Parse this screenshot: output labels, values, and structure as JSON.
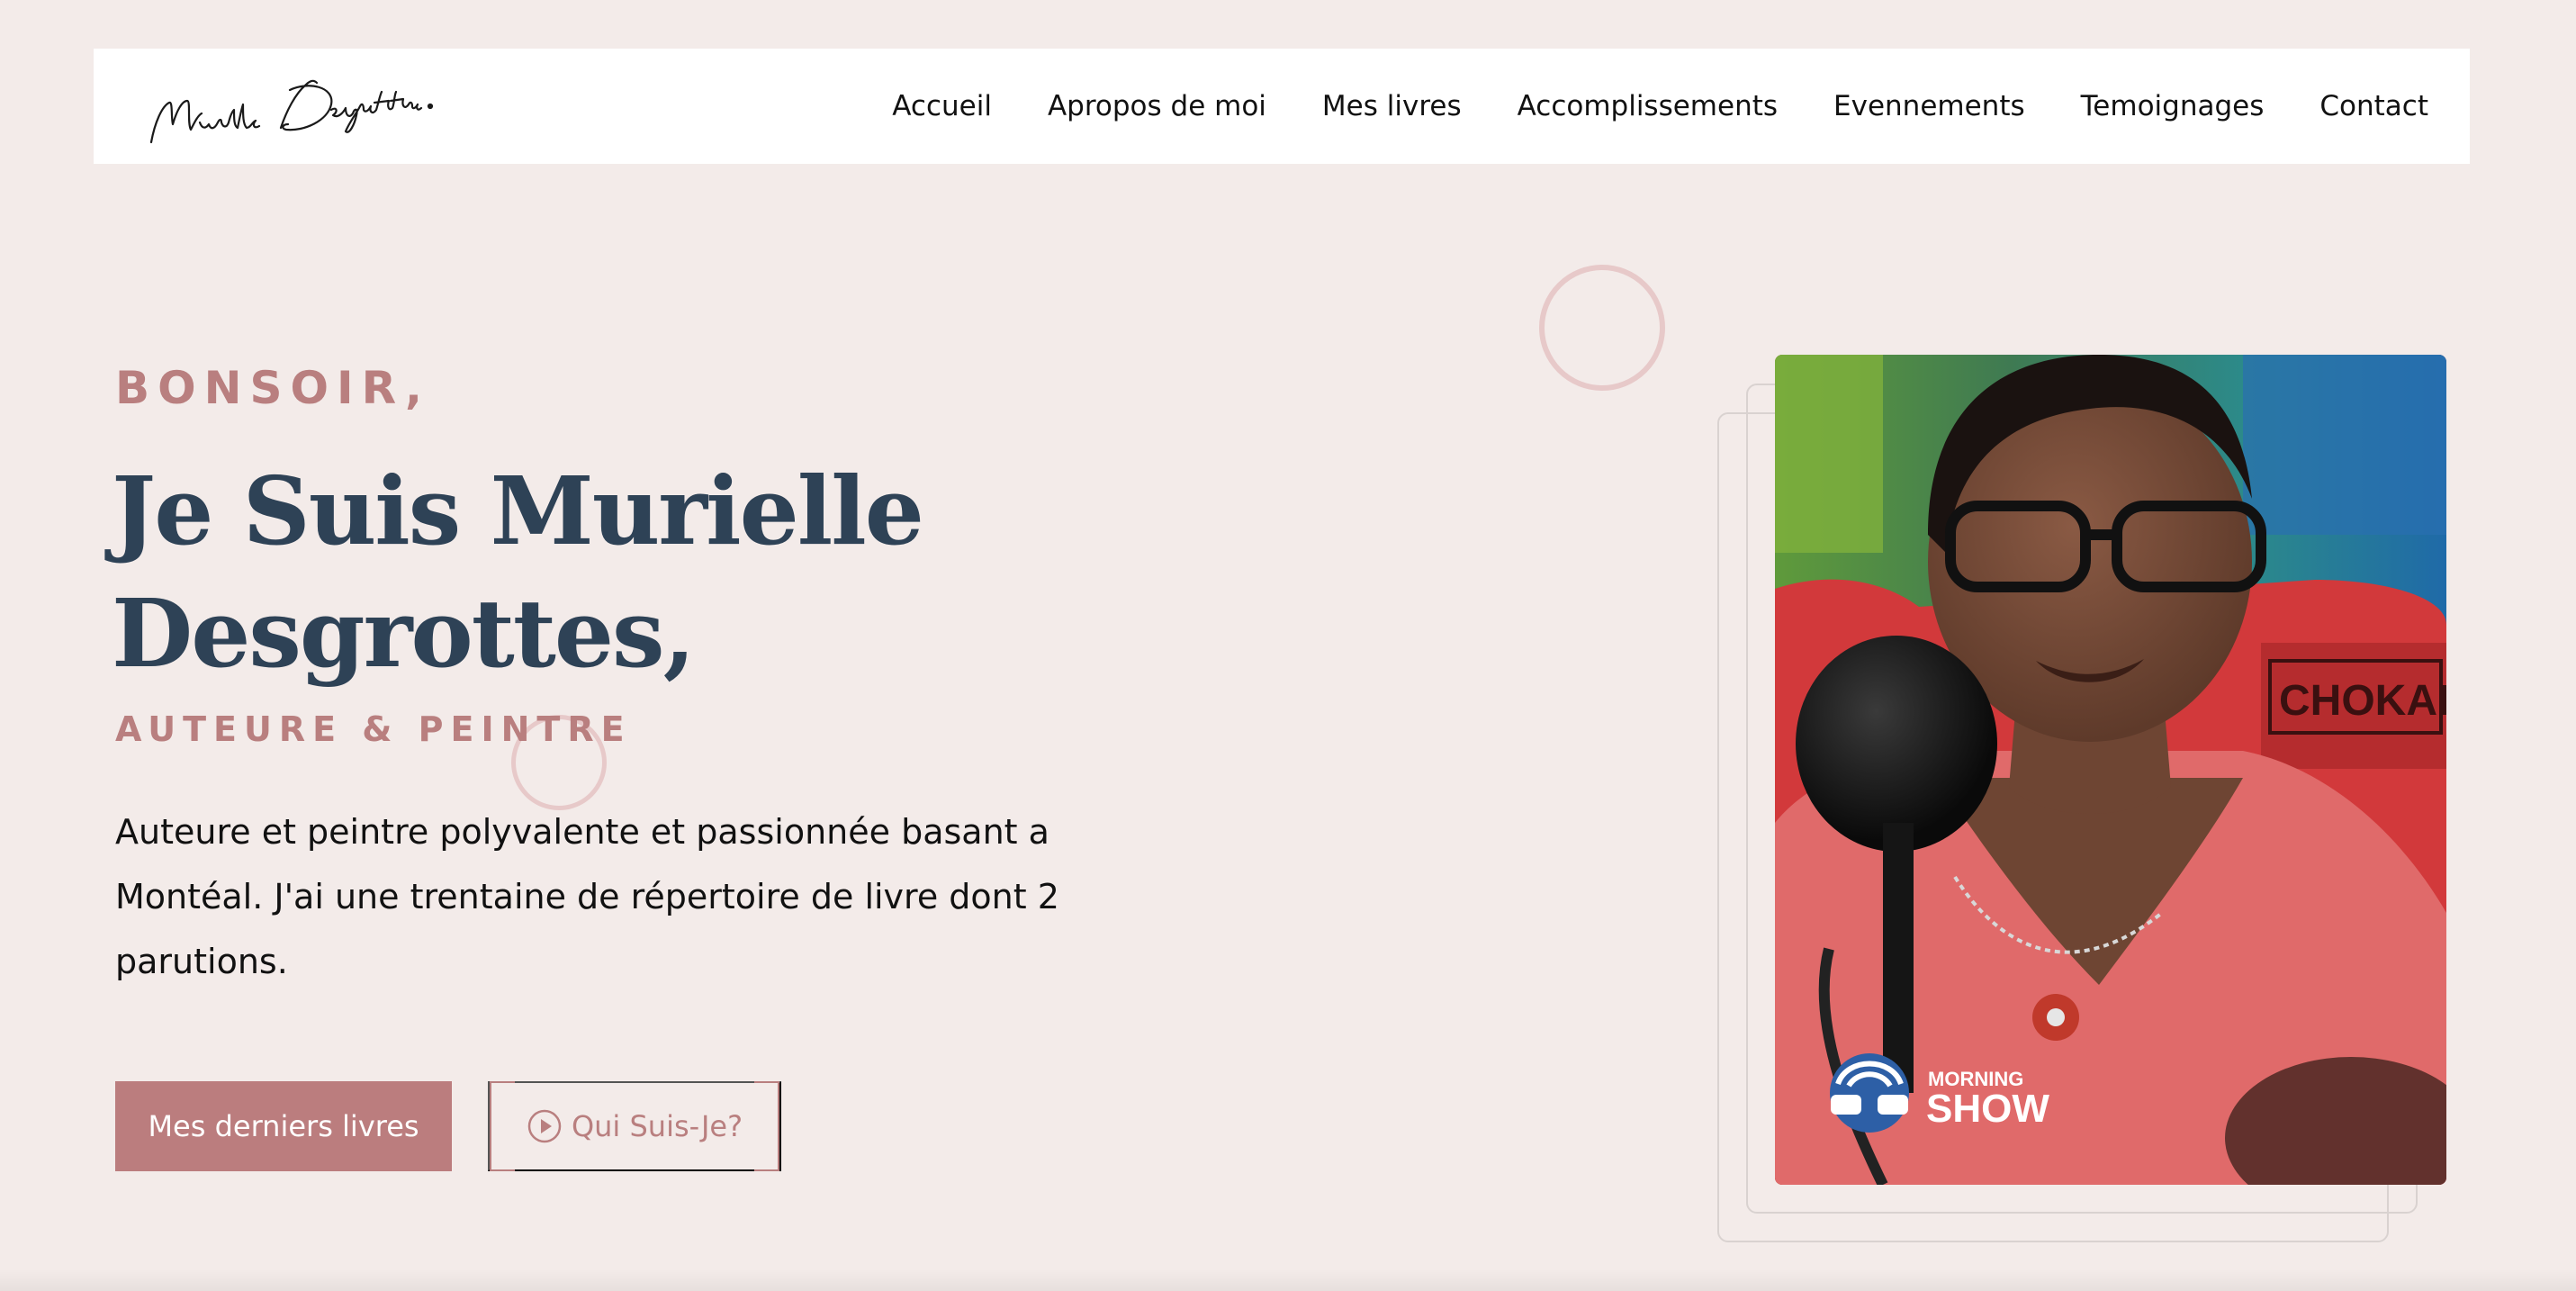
{
  "header": {
    "logo_text": "Murielle Desgrottes.",
    "nav": [
      {
        "label": "Accueil"
      },
      {
        "label": "Apropos de moi"
      },
      {
        "label": "Mes livres"
      },
      {
        "label": "Accomplissements"
      },
      {
        "label": "Evennements"
      },
      {
        "label": "Temoignages"
      },
      {
        "label": "Contact"
      }
    ]
  },
  "hero": {
    "greeting": "BONSOIR,",
    "title_line1": "Je Suis Murielle",
    "title_line2": "Desgrottes,",
    "subtitle": "AUTEURE & PEINTRE",
    "description": "Auteure et peintre polyvalente et passionnée basant a Montéal. J'ai une trentaine de répertoire de livre dont 2 parutions.",
    "primary_button": "Mes derniers livres",
    "secondary_button": "Qui Suis-Je?"
  },
  "photo": {
    "chair_text": "CHOKARE",
    "show_badge_top": "MORNING",
    "show_badge_bottom": "SHOW"
  },
  "colors": {
    "background": "#f3ebe9",
    "accent": "#b97f7f",
    "title": "#2e4256",
    "button": "#bb7d7e"
  },
  "icons": {
    "play": "play-circle-icon"
  }
}
